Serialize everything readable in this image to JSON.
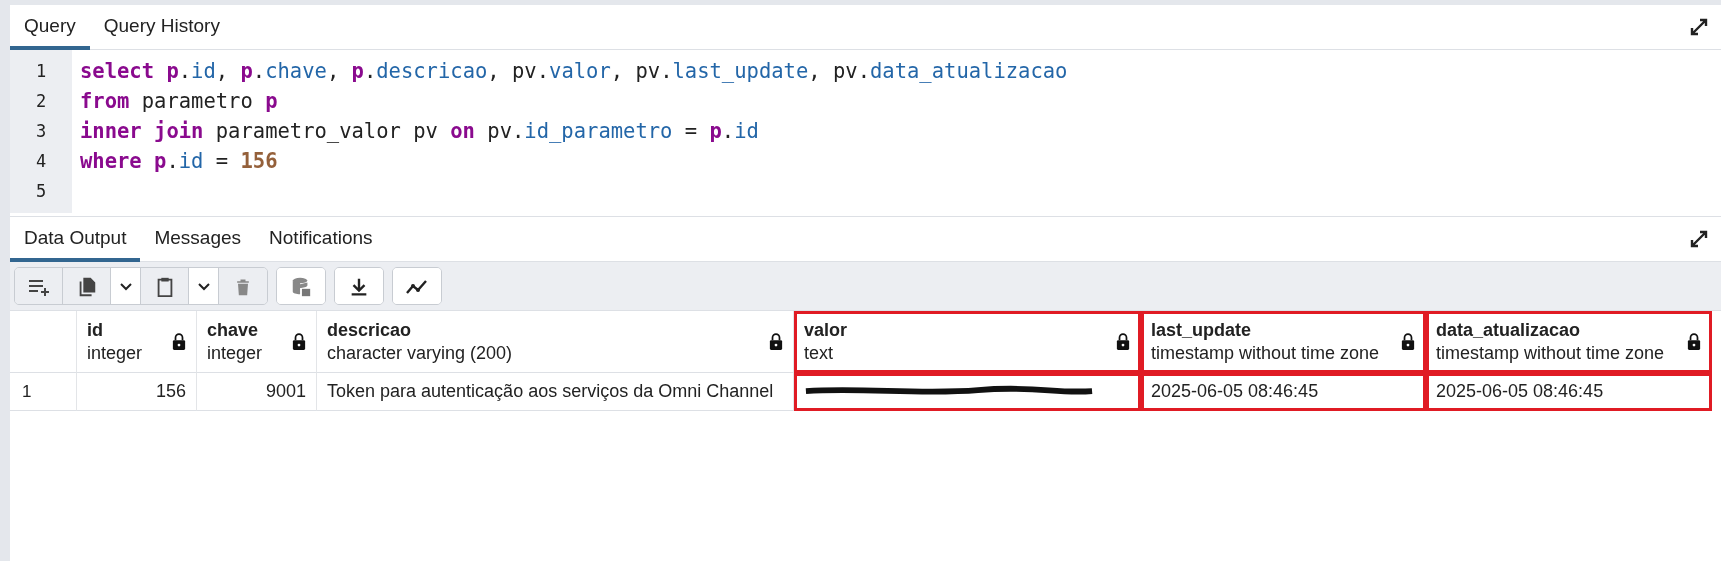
{
  "editor_tabs": [
    {
      "label": "Query",
      "selected": true
    },
    {
      "label": "Query History",
      "selected": false
    }
  ],
  "editor": {
    "lines": [
      {
        "number": "1",
        "tokens": [
          {
            "kind": "keyword",
            "text": "select"
          },
          {
            "kind": "alias",
            "text": " p"
          },
          {
            "kind": "plain",
            "text": "."
          },
          {
            "kind": "field",
            "text": "id"
          },
          {
            "kind": "plain",
            "text": ", "
          },
          {
            "kind": "alias",
            "text": "p"
          },
          {
            "kind": "plain",
            "text": "."
          },
          {
            "kind": "field",
            "text": "chave"
          },
          {
            "kind": "plain",
            "text": ", "
          },
          {
            "kind": "alias",
            "text": "p"
          },
          {
            "kind": "plain",
            "text": "."
          },
          {
            "kind": "field",
            "text": "descricao"
          },
          {
            "kind": "plain",
            "text": ", pv."
          },
          {
            "kind": "field",
            "text": "valor"
          },
          {
            "kind": "plain",
            "text": ", pv."
          },
          {
            "kind": "field",
            "text": "last_update"
          },
          {
            "kind": "plain",
            "text": ", pv."
          },
          {
            "kind": "field",
            "text": "data_atualizacao"
          }
        ]
      },
      {
        "number": "2",
        "tokens": [
          {
            "kind": "keyword",
            "text": "from"
          },
          {
            "kind": "plain",
            "text": " parametro "
          },
          {
            "kind": "alias",
            "text": "p"
          }
        ]
      },
      {
        "number": "3",
        "tokens": [
          {
            "kind": "keyword",
            "text": "inner join"
          },
          {
            "kind": "plain",
            "text": " parametro_valor pv "
          },
          {
            "kind": "keyword",
            "text": "on"
          },
          {
            "kind": "plain",
            "text": " pv."
          },
          {
            "kind": "field",
            "text": "id_parametro"
          },
          {
            "kind": "plain",
            "text": " = "
          },
          {
            "kind": "alias",
            "text": "p"
          },
          {
            "kind": "plain",
            "text": "."
          },
          {
            "kind": "field",
            "text": "id"
          }
        ]
      },
      {
        "number": "4",
        "tokens": [
          {
            "kind": "keyword",
            "text": "where"
          },
          {
            "kind": "alias",
            "text": " p"
          },
          {
            "kind": "plain",
            "text": "."
          },
          {
            "kind": "field",
            "text": "id"
          },
          {
            "kind": "plain",
            "text": " = "
          },
          {
            "kind": "number",
            "text": "156"
          }
        ]
      },
      {
        "number": "5"
      }
    ]
  },
  "output_tabs": [
    {
      "label": "Data Output",
      "selected": true
    },
    {
      "label": "Messages",
      "selected": false
    },
    {
      "label": "Notifications",
      "selected": false
    }
  ],
  "table": {
    "columns": [
      {
        "name": "id",
        "type": "integer",
        "highlighted": false
      },
      {
        "name": "chave",
        "type": "integer",
        "highlighted": false
      },
      {
        "name": "descricao",
        "type": "character varying (200)",
        "highlighted": false
      },
      {
        "name": "valor",
        "type": "text",
        "highlighted": true
      },
      {
        "name": "last_update",
        "type": "timestamp without time zone",
        "highlighted": true
      },
      {
        "name": "data_atualizacao",
        "type": "timestamp without time zone",
        "highlighted": true
      }
    ],
    "rows": [
      {
        "number": "1",
        "cells": [
          {
            "text": "156",
            "right_aligned": true,
            "redacted": false
          },
          {
            "text": "9001",
            "right_aligned": true,
            "redacted": false
          },
          {
            "text": "Token para autenticação aos serviços da Omni Channel",
            "right_aligned": false,
            "redacted": false
          },
          {
            "right_aligned": false,
            "redacted": true
          },
          {
            "text": "2025-06-05 08:46:45",
            "right_aligned": false,
            "redacted": false
          },
          {
            "text": "2025-06-05 08:46:45",
            "right_aligned": false,
            "redacted": false
          }
        ]
      }
    ]
  }
}
